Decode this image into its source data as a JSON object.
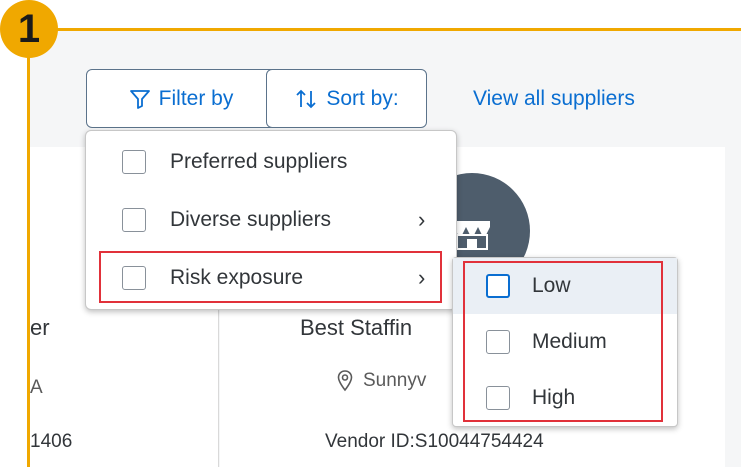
{
  "step_number": "1",
  "toolbar": {
    "filter_label": "Filter by",
    "sort_label": "Sort by:",
    "view_all_label": "View all suppliers"
  },
  "filter_menu": {
    "items": [
      {
        "label": "Preferred suppliers",
        "checked": false,
        "has_submenu": false
      },
      {
        "label": "Diverse suppliers",
        "checked": false,
        "has_submenu": true
      },
      {
        "label": "Risk exposure",
        "checked": false,
        "has_submenu": true
      }
    ]
  },
  "risk_submenu": {
    "items": [
      {
        "label": "Low",
        "checked": false
      },
      {
        "label": "Medium",
        "checked": false
      },
      {
        "label": "High",
        "checked": false
      }
    ]
  },
  "cards": {
    "left": {
      "name_fragment": "er",
      "location_fragment": "A",
      "vendor_fragment": "1406"
    },
    "right": {
      "name": "Best Staffin",
      "location": "Sunnyv",
      "vendor_id": "Vendor ID:S10044754424"
    }
  },
  "colors": {
    "callout": "#f0a800",
    "accent": "#0a6ed1",
    "highlight": "#e1313a"
  },
  "icons": {
    "filter": "funnel-icon",
    "sort": "sort-arrows-icon",
    "chevron": "chevron-right-icon",
    "location": "location-pin-icon",
    "store": "storefront-icon"
  }
}
